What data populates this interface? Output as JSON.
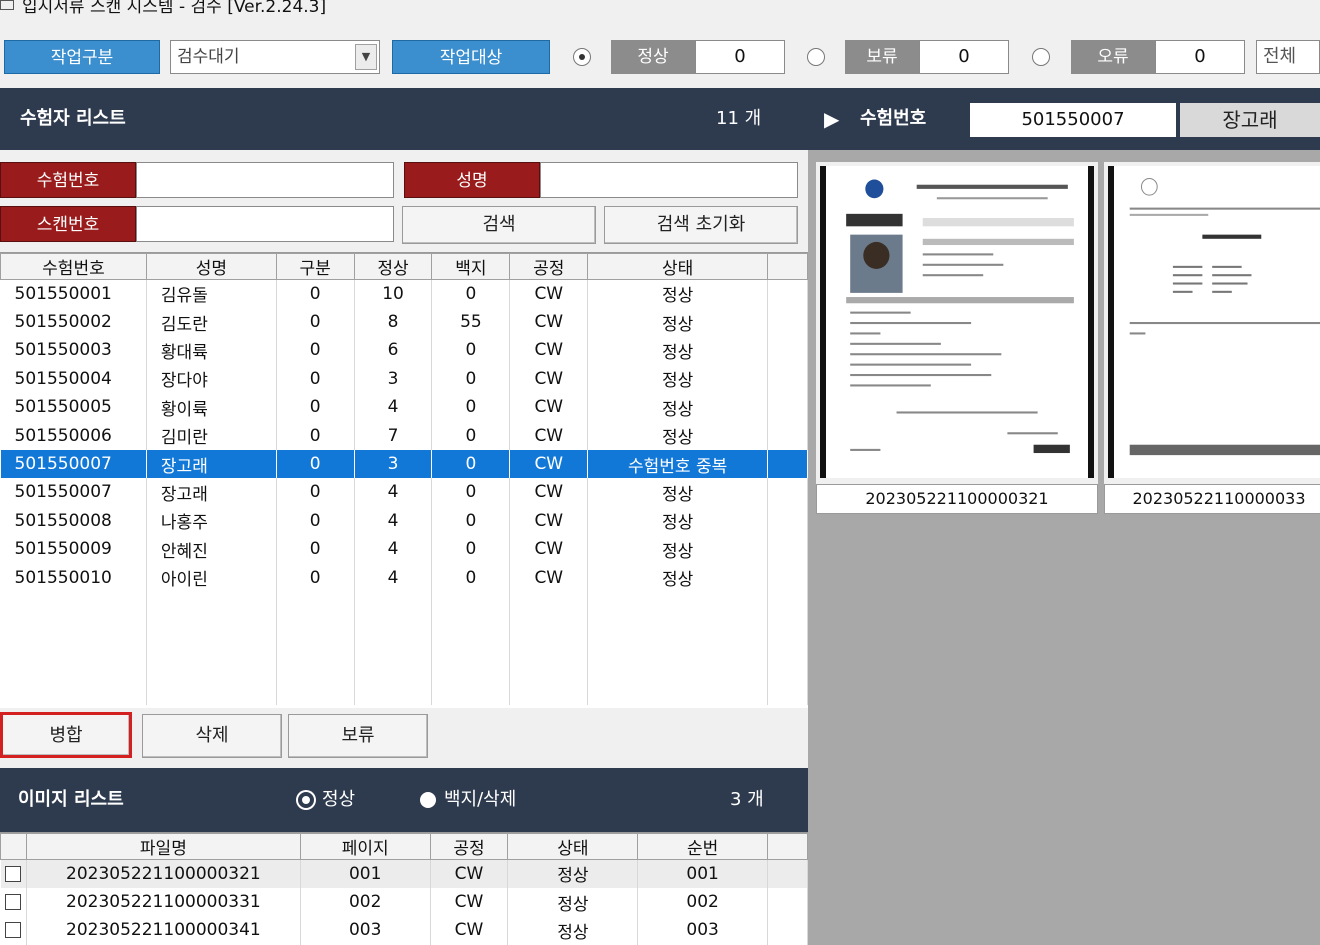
{
  "window": {
    "title": "입시서류 스캔 시스템 - 검수 [Ver.2.24.3]"
  },
  "toolbar": {
    "work_type_button": "작업구분",
    "work_type_value": "검수대기",
    "work_target_button": "작업대상",
    "counters": [
      {
        "label": "정상",
        "value": "0",
        "selected": true
      },
      {
        "label": "보류",
        "value": "0",
        "selected": false
      },
      {
        "label": "오류",
        "value": "0",
        "selected": false
      }
    ],
    "all_label": "전체"
  },
  "examinee_panel": {
    "title": "수험자 리스트",
    "count": "11 개",
    "number_label": "수험번호",
    "number_value": "501550007",
    "name_value": "장고래"
  },
  "search": {
    "exam_number_label": "수험번호",
    "name_label": "성명",
    "scan_number_label": "스캔번호",
    "search_button": "검색",
    "reset_button": "검색 초기화"
  },
  "examinee_table": {
    "columns": [
      "수험번호",
      "성명",
      "구분",
      "정상",
      "백지",
      "공정",
      "상태"
    ],
    "rows": [
      [
        "501550001",
        "김유돌",
        "0",
        "10",
        "0",
        "CW",
        "정상"
      ],
      [
        "501550002",
        "김도란",
        "0",
        "8",
        "55",
        "CW",
        "정상"
      ],
      [
        "501550003",
        "황대륙",
        "0",
        "6",
        "0",
        "CW",
        "정상"
      ],
      [
        "501550004",
        "장다야",
        "0",
        "3",
        "0",
        "CW",
        "정상"
      ],
      [
        "501550005",
        "황이륙",
        "0",
        "4",
        "0",
        "CW",
        "정상"
      ],
      [
        "501550006",
        "김미란",
        "0",
        "7",
        "0",
        "CW",
        "정상"
      ],
      [
        "501550007",
        "장고래",
        "0",
        "3",
        "0",
        "CW",
        "수험번호 중복"
      ],
      [
        "501550007",
        "장고래",
        "0",
        "4",
        "0",
        "CW",
        "정상"
      ],
      [
        "501550008",
        "나홍주",
        "0",
        "4",
        "0",
        "CW",
        "정상"
      ],
      [
        "501550009",
        "안혜진",
        "0",
        "4",
        "0",
        "CW",
        "정상"
      ],
      [
        "501550010",
        "아이린",
        "0",
        "4",
        "0",
        "CW",
        "정상"
      ]
    ],
    "selected_row": 6
  },
  "actions": {
    "merge": "병합",
    "delete": "삭제",
    "hold": "보류"
  },
  "image_panel": {
    "title": "이미지 리스트",
    "filter_normal": "정상",
    "filter_blank": "백지/삭제",
    "count": "3 개"
  },
  "image_table": {
    "columns": [
      "",
      "파일명",
      "페이지",
      "공정",
      "상태",
      "순번"
    ],
    "rows": [
      [
        "",
        "202305221100000321",
        "001",
        "CW",
        "정상",
        "001"
      ],
      [
        "",
        "202305221100000331",
        "002",
        "CW",
        "정상",
        "002"
      ],
      [
        "",
        "202305221100000341",
        "003",
        "CW",
        "정상",
        "003"
      ]
    ]
  },
  "thumbnails": [
    {
      "caption": "202305221100000321"
    },
    {
      "caption": "20230522110000033"
    }
  ],
  "colors": {
    "header_bg": "#2e3a4e",
    "accent_blue": "#3b8fcf",
    "label_red": "#9a1b1b",
    "selection": "#1278d8",
    "highlight_frame": "#d42020"
  }
}
